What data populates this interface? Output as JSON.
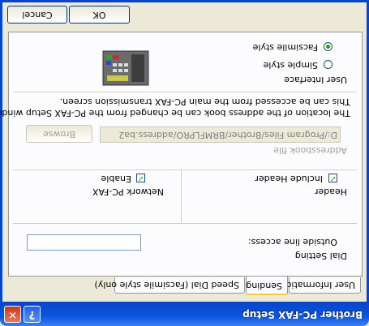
{
  "window": {
    "title": "Brother PC-FAX Setup",
    "help_glyph": "?",
    "close_glyph": "✕"
  },
  "tabs": [
    {
      "label": "User Information",
      "active": false
    },
    {
      "label": "Sending",
      "active": true
    },
    {
      "label": "Speed Dial (Facsimile style only)",
      "active": false
    }
  ],
  "dial_setting": {
    "group_label": "Dial Setting",
    "outside_line_label": "Outside line access:",
    "outside_line_value": ""
  },
  "header": {
    "group_label": "Header",
    "include_header_label": "Include Header",
    "include_header_checked": true
  },
  "network_pcfax": {
    "group_label": "Network PC-FAX",
    "enable_label": "Enable",
    "enable_checked": true
  },
  "addressbook": {
    "label": "Addressbook file",
    "path": "D:/Program Files/Brother/BRMFLPRO/address.ba2",
    "browse_label": "Browse",
    "note_line1": "The location of the address book can be changed from the PC-FAX Setup window.",
    "note_line2": "This can be accessed from the main PC-FAX transmission screen."
  },
  "user_interface": {
    "group_label": "User Interface",
    "options": [
      {
        "label": "Simple style",
        "selected": false
      },
      {
        "label": "Facsimile style",
        "selected": true
      }
    ]
  },
  "buttons": {
    "ok": "OK",
    "cancel": "Cancel"
  },
  "colors": {
    "titlebar": "#0a54e0",
    "panel": "#fcfcfe",
    "dialog_bg": "#ece9d8",
    "check_mark": "#21a121"
  }
}
